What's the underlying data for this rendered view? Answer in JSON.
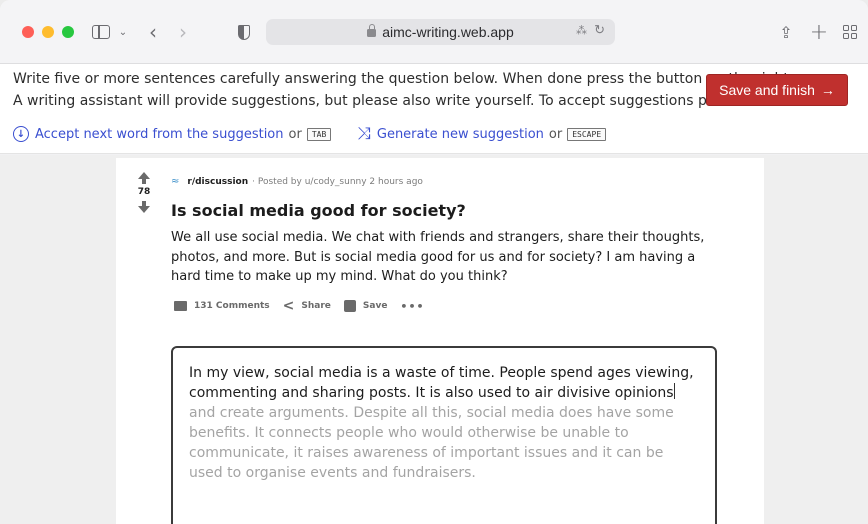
{
  "browser": {
    "url": "aimc-writing.web.app",
    "icons": [
      "sidebar-icon",
      "chevron-down-icon",
      "back-icon",
      "forward-icon",
      "shield-icon",
      "lock-icon",
      "translate-icon",
      "reload-icon",
      "share-icon",
      "plus-icon",
      "tabs-icon"
    ]
  },
  "instructions": {
    "line1": "Write five or more sentences carefully answering the question below. When done press the button on the right.",
    "line2": "A writing assistant will provide suggestions, but please also write yourself. To accept suggestions press TAB .",
    "finish_label": "Save and finish",
    "finish_arrow": "→",
    "accept_hint": "Accept next word from the suggestion",
    "accept_key": "TAB",
    "or1": "or",
    "generate_hint": "Generate new suggestion",
    "generate_key": "ESCAPE",
    "or2": "or"
  },
  "post": {
    "votes": "78",
    "subreddit": "r/discussion",
    "posted_by": "· Posted by u/cody_sunny 2 hours ago",
    "title": "Is social media good for society?",
    "body": "We all use social media. We chat with friends and strangers, share their thoughts, photos, and more. But is social media good for us and for society? I am having a hard time to make up my mind. What do you think?",
    "comments_label": "131 Comments",
    "share_label": "Share",
    "save_label": "Save",
    "more_label": "•••"
  },
  "editor": {
    "typed_text": "In my view, social media is a waste of time. People spend ages viewing, commenting and sharing posts. It is also used to air divisive opinions",
    "suggestion_text": "and create arguments. Despite all this, social media does have some benefits. It connects people who would otherwise be unable to communicate, it raises awareness of important issues and it can be used to organise events and fundraisers."
  },
  "colors": {
    "finish_button": "#c0302e",
    "link_blue": "#3a4fd0",
    "suggestion_gray": "#a4a4a4"
  }
}
